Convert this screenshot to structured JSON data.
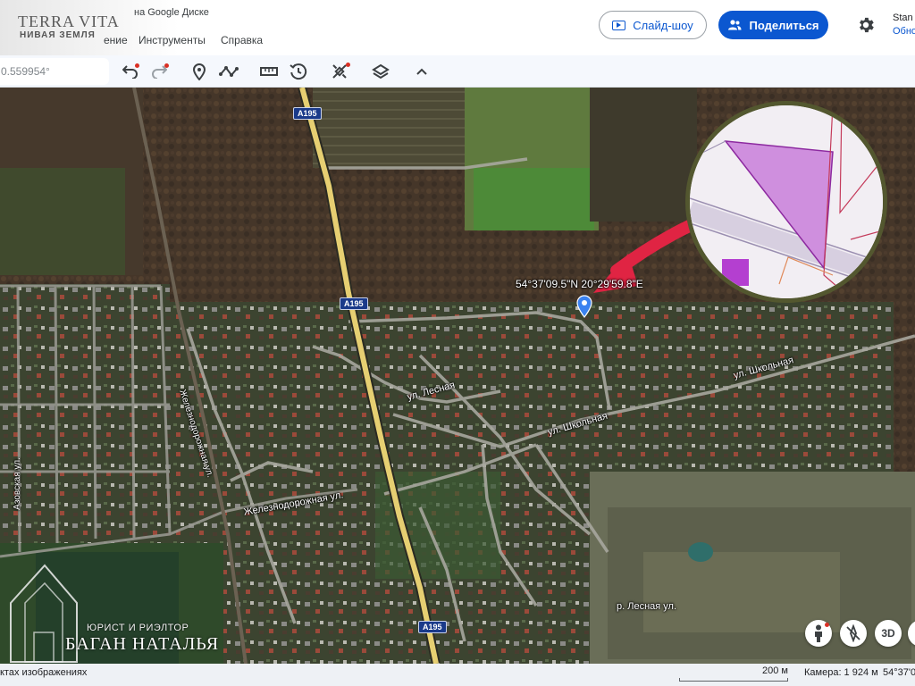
{
  "watermark": {
    "logo_title": "TERRA VITA",
    "logo_subtitle": "НИВАЯ ЗЕМЛЯ",
    "agent_role": "ЮРИСТ И РИЭЛТОР",
    "agent_name": "БАГАН НАТАЛЬЯ"
  },
  "header": {
    "drive_text": "на Google Диске",
    "menu": [
      "ение",
      "Инструменты",
      "Справка"
    ],
    "slideshow_label": "Слайд-шоу",
    "share_label": "Поделиться",
    "account_name": "Stan",
    "account_sub": "Обно"
  },
  "toolbar": {
    "coordinate_value": "0.559954°",
    "icons": [
      "undo-icon",
      "redo-icon",
      "place-pin-icon",
      "path-icon",
      "ruler-icon",
      "history-icon",
      "satellite-icon",
      "layers-icon",
      "collapse-icon"
    ]
  },
  "map": {
    "highway": "A195",
    "pin_coordinates": "54°37'09.5\"N 20°29'59.8\"E",
    "streets": {
      "lesnaya": "ул. Лесная",
      "shkolnaya_1": "ул. Школьная",
      "shkolnaya_2": "ул. Школьная",
      "zheleznodorozhnaya_ul": "Железнодорожная ул.",
      "zheleznodorozhnaya_vert": "Железнодорожная ул.",
      "azovskaya": "Азовская ул.",
      "river": "р. Лесная ул."
    },
    "buttons": {
      "three_d": "3D"
    }
  },
  "status": {
    "attribution": "ктах изображениях",
    "scale": "200 м",
    "camera": "Камера: 1 924 м",
    "coordinates": "54°37'0"
  },
  "colors": {
    "accent": "#0b57d0",
    "highway": "#e6cf72",
    "parcel": "#c77ad6",
    "arrow": "#e02443"
  }
}
